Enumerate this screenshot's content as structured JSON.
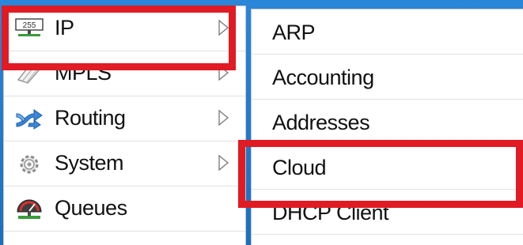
{
  "main_menu": {
    "items": [
      {
        "label": "IP",
        "icon": "ip-address-icon",
        "has_submenu": true
      },
      {
        "label": "MPLS",
        "icon": "mpls-tags-icon",
        "has_submenu": true
      },
      {
        "label": "Routing",
        "icon": "routing-arrows-icon",
        "has_submenu": true
      },
      {
        "label": "System",
        "icon": "gear-icon",
        "has_submenu": true
      },
      {
        "label": "Queues",
        "icon": "queue-gauge-icon",
        "has_submenu": false
      }
    ]
  },
  "ip_submenu": {
    "items": [
      {
        "label": "ARP"
      },
      {
        "label": "Accounting"
      },
      {
        "label": "Addresses"
      },
      {
        "label": "Cloud"
      },
      {
        "label": "DHCP Client"
      }
    ]
  },
  "colors": {
    "highlight": "#e01b24",
    "background": "#1f78c8"
  }
}
